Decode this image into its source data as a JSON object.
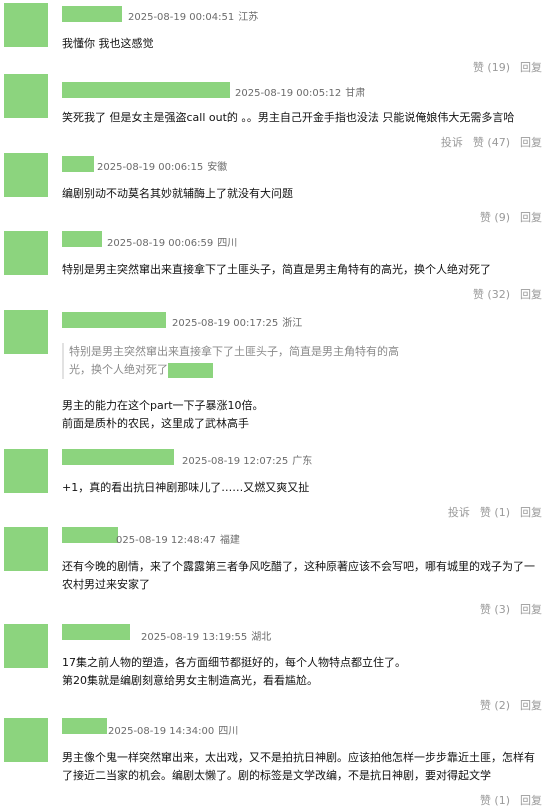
{
  "comments": [
    {
      "date": "2025-08-19 00:04:51",
      "region": "江苏",
      "text": "我懂你 我也这感觉",
      "like": "赞 (19)",
      "reply": "回复"
    },
    {
      "date": "2025-08-19 00:05:12",
      "region": "甘肃",
      "text": "笑死我了 但是女主是强盗call out的 。。男主自己开金手指也没法 只能说俺娘伟大无需多言哈",
      "report": "投诉",
      "like": "赞 (47)",
      "reply": "回复"
    },
    {
      "date": "2025-08-19 00:06:15",
      "region": "安徽",
      "text": "编剧别动不动莫名其妙就辅酶上了就没有大问题",
      "like": "赞 (9)",
      "reply": "回复"
    },
    {
      "date": "2025-08-19 00:06:59",
      "region": "四川",
      "text": "特别是男主突然窜出来直接拿下了土匪头子，简直是男主角特有的高光，换个人绝对死了",
      "like": "赞 (32)",
      "reply": "回复"
    },
    {
      "date": "2025-08-19 00:17:25",
      "region": "浙江",
      "quote_line1": "特别是男主突然窜出来直接拿下了土匪头子，简直是男主角特有的高",
      "quote_line2": "光，换个人绝对死了",
      "line1": "男主的能力在这个part一下子暴涨10倍。",
      "line2": "前面是质朴的农民，这里成了武林高手"
    },
    {
      "date": "2025-08-19 12:07:25",
      "region": "广东",
      "text": "+1，真的看出抗日神剧那味儿了……又燃又爽又扯",
      "report": "投诉",
      "like": "赞 (1)",
      "reply": "回复"
    },
    {
      "date": "025-08-19 12:48:47",
      "region": "福建",
      "line1": "还有今晚的剧情，来了个露露第三者争风吃醋了，这种原著应该不会写吧，哪有城里的戏子为了一",
      "line2": "农村男过来安家了",
      "like": "赞 (3)",
      "reply": "回复"
    },
    {
      "date": "2025-08-19 13:19:55",
      "region": "湖北",
      "line1": "17集之前人物的塑造，各方面细节都挺好的，每个人物特点都立住了。",
      "line2": "第20集就是编剧刻意给男女主制造高光，看看尴尬。",
      "like": "赞 (2)",
      "reply": "回复"
    },
    {
      "date": "2025-08-19 14:34:00",
      "region": "四川",
      "line1": "男主像个鬼一样突然窜出来，太出戏，又不是拍抗日神剧。应该拍他怎样一步步靠近土匪，怎样有",
      "line2": "了接近二当家的机会。编剧太懒了。剧的标签是文学改编，不是抗日神剧，要对得起文学",
      "like": "赞 (1)",
      "reply": "回复"
    }
  ]
}
